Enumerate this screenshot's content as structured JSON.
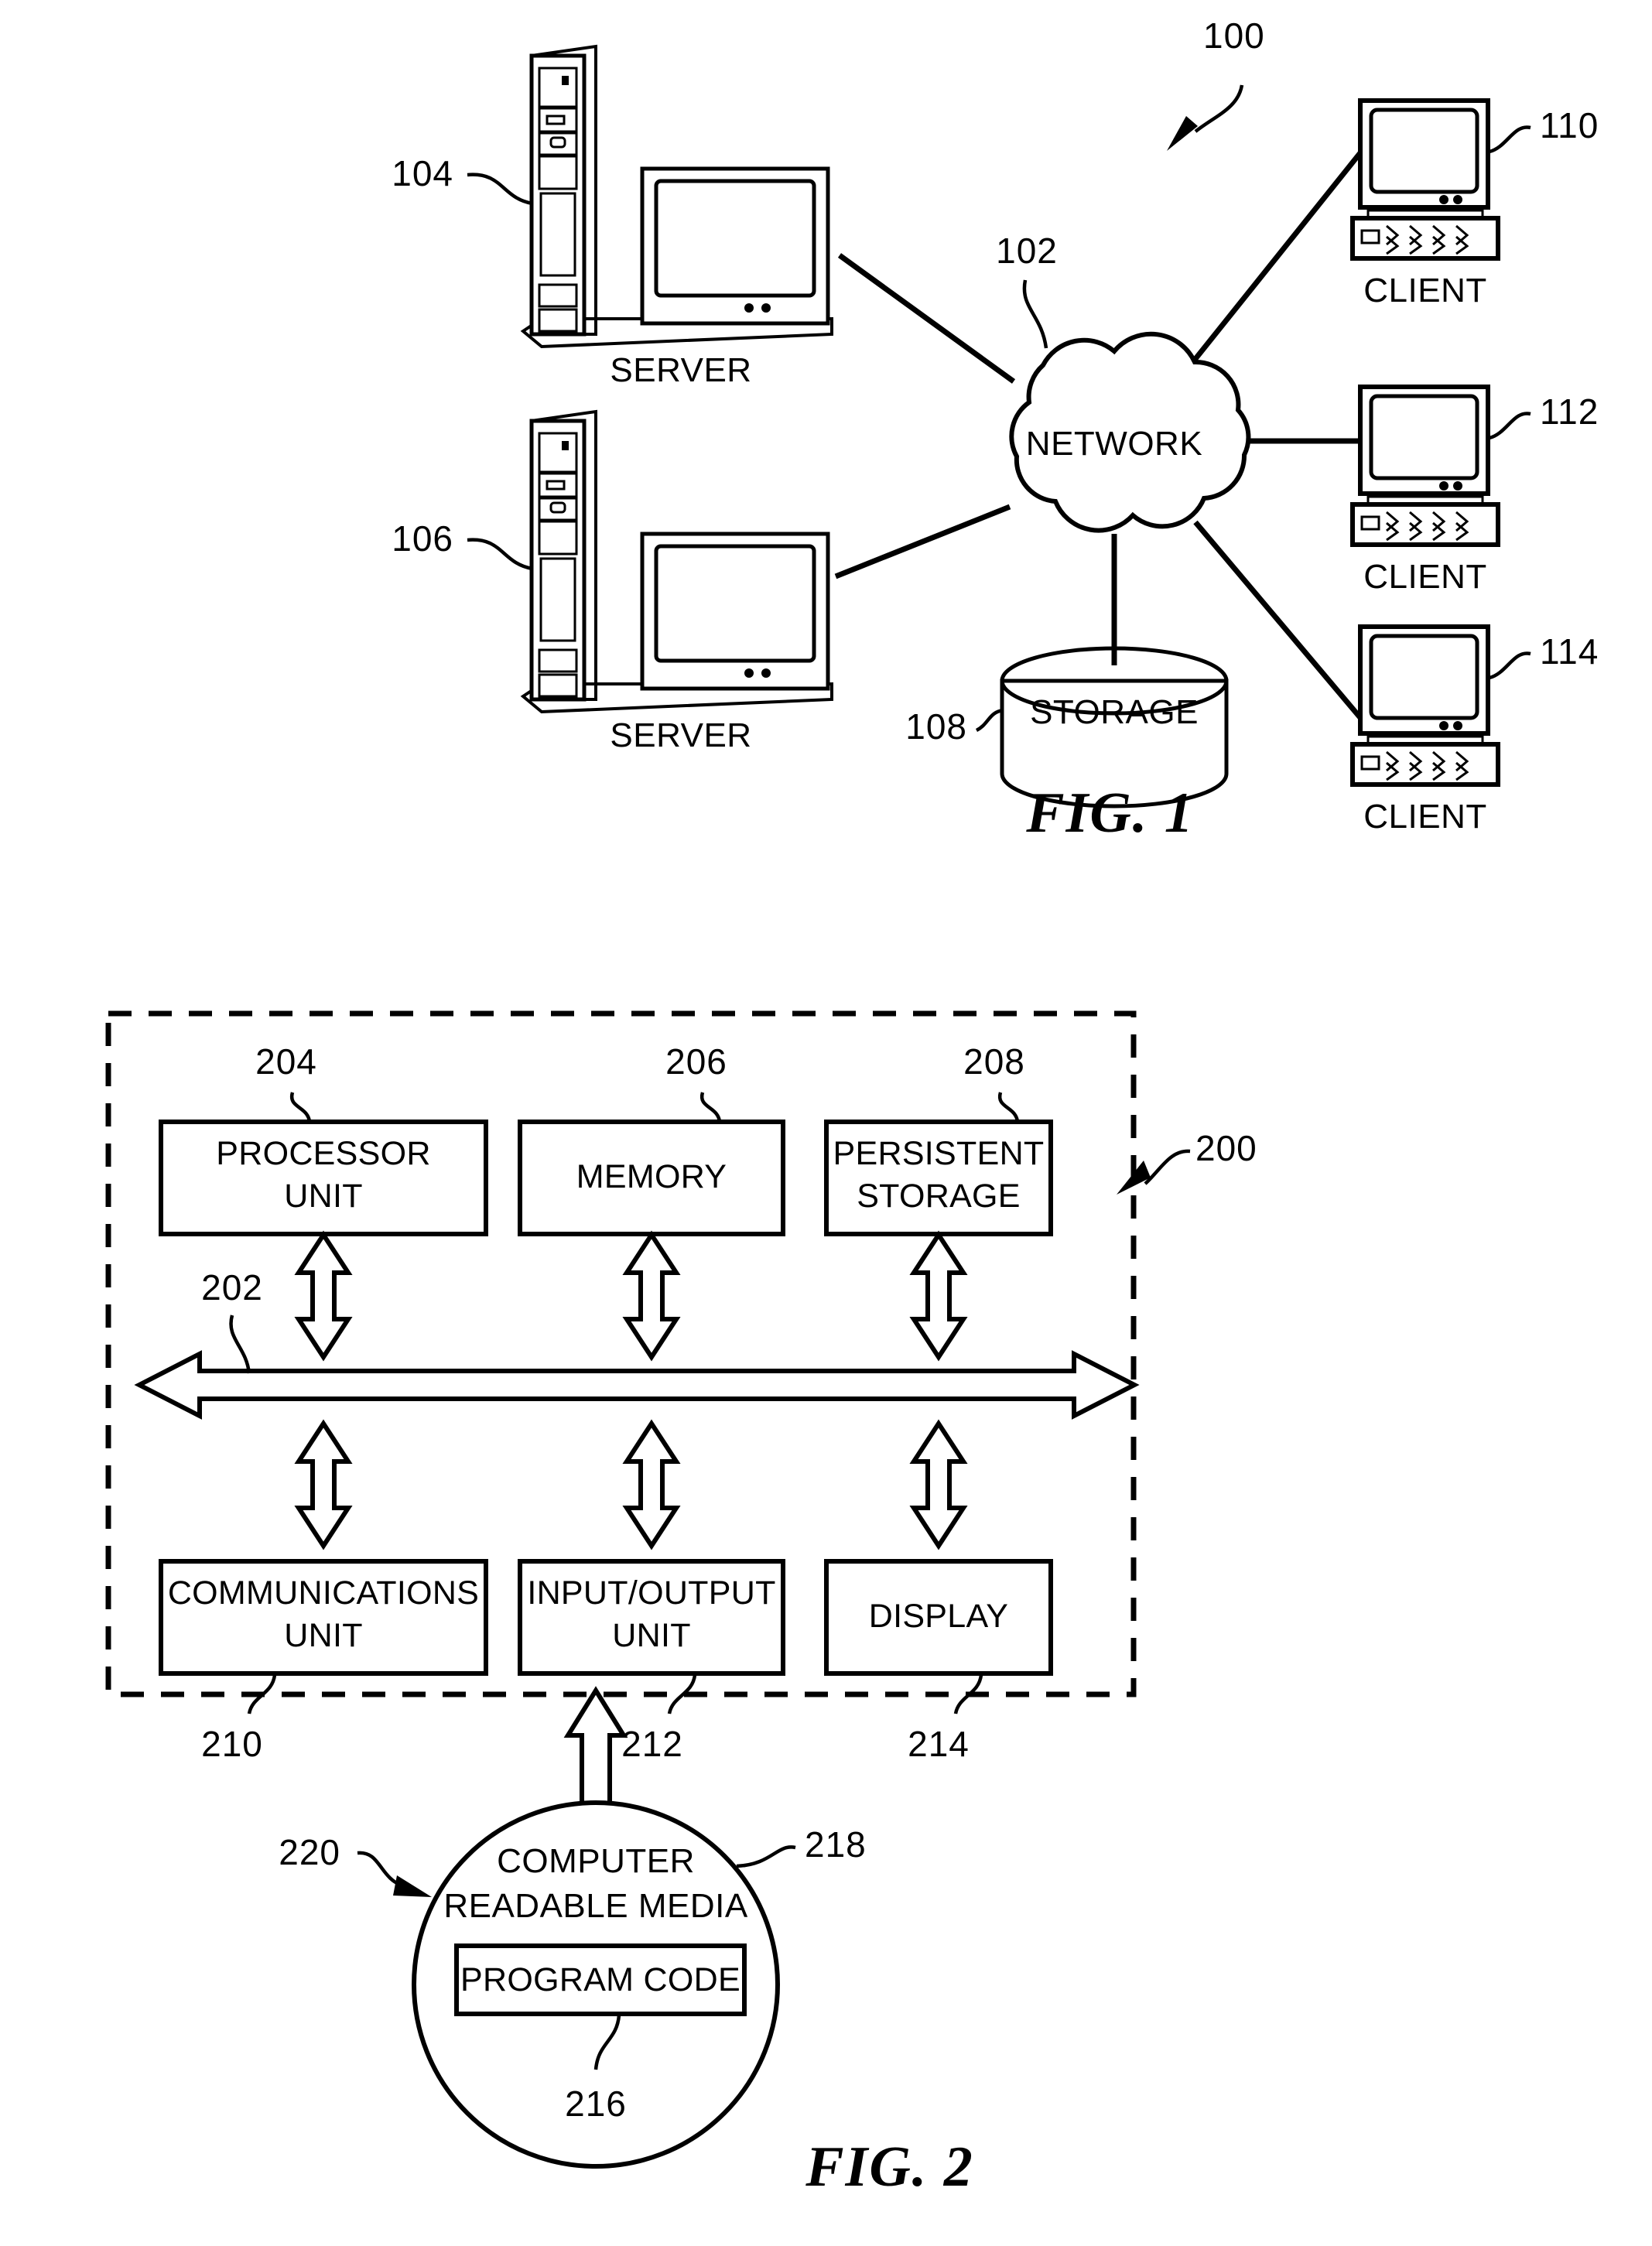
{
  "document": {
    "type": "patent-drawing-sheet",
    "figures": [
      {
        "id": "fig1",
        "caption": "FIG. 1",
        "system_ref": "100",
        "nodes": [
          {
            "ref": "104",
            "label": "SERVER",
            "kind": "server"
          },
          {
            "ref": "106",
            "label": "SERVER",
            "kind": "server"
          },
          {
            "ref": "102",
            "label": "NETWORK",
            "kind": "cloud"
          },
          {
            "ref": "108",
            "label": "STORAGE",
            "kind": "cylinder"
          },
          {
            "ref": "110",
            "label": "CLIENT",
            "kind": "client"
          },
          {
            "ref": "112",
            "label": "CLIENT",
            "kind": "client"
          },
          {
            "ref": "114",
            "label": "CLIENT",
            "kind": "client"
          }
        ]
      },
      {
        "id": "fig2",
        "caption": "FIG. 2",
        "system_ref": "200",
        "bus_ref": "202",
        "boxes": [
          {
            "ref": "204",
            "line1": "PROCESSOR",
            "line2": "UNIT"
          },
          {
            "ref": "206",
            "line1": "MEMORY",
            "line2": ""
          },
          {
            "ref": "208",
            "line1": "PERSISTENT",
            "line2": "STORAGE"
          },
          {
            "ref": "210",
            "line1": "COMMUNICATIONS",
            "line2": "UNIT"
          },
          {
            "ref": "212",
            "line1": "INPUT/OUTPUT",
            "line2": "UNIT"
          },
          {
            "ref": "214",
            "line1": "DISPLAY",
            "line2": ""
          }
        ],
        "media": {
          "ref": "220",
          "circle_ref": "218",
          "circle_line1": "COMPUTER",
          "circle_line2": "READABLE MEDIA",
          "inner_ref": "216",
          "inner_label": "PROGRAM CODE"
        }
      }
    ]
  },
  "colors": {
    "ink": "#000000",
    "paper": "#ffffff"
  }
}
